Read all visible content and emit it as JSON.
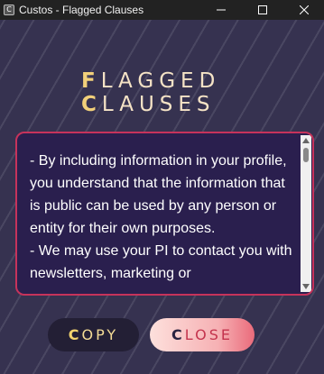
{
  "window": {
    "title": "Custos - Flagged Clauses",
    "app_icon": "custos-app-icon"
  },
  "logo": {
    "line1_first": "F",
    "line1_rest": "LAGGED",
    "line2_first": "C",
    "line2_rest": "LAUSES"
  },
  "clauses_text": "- By including information in your profile, you understand that the information that is public can be used by any person or entity for their own purposes.\n- We may use your PI to contact you with newsletters, marketing or",
  "buttons": {
    "copy_first": "C",
    "copy_rest": "OPY",
    "close_first": "C",
    "close_rest": "LOSE"
  },
  "colors": {
    "background": "#363250",
    "textbox_border": "#c6335b",
    "textbox_bg": "#2a1f4e",
    "accent_gold": "#f2d07a"
  }
}
